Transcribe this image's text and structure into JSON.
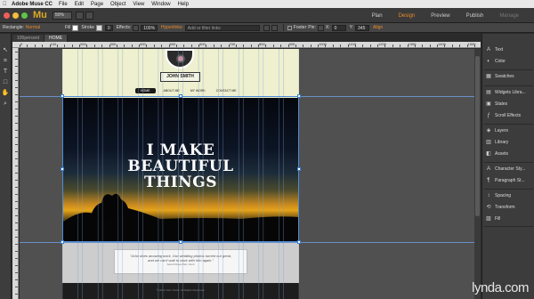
{
  "menubar": {
    "app_name": "Adobe Muse CC",
    "items": [
      "File",
      "Edit",
      "Page",
      "Object",
      "View",
      "Window",
      "Help"
    ]
  },
  "appbar": {
    "logo": "Mu",
    "zoom": "50%",
    "modes": [
      "Plan",
      "Design",
      "Preview",
      "Publish",
      "Manage"
    ],
    "active_mode": "Design",
    "colors": {
      "traffic_red": "#ee5f58",
      "traffic_yellow": "#f5bd3d",
      "traffic_green": "#5fc549",
      "accent": "#e98a2a"
    }
  },
  "controlbar": {
    "selection_label": "Rectangle:",
    "selection_value": "Normal",
    "fill_label": "Fill",
    "stroke_label": "Stroke",
    "stroke_value": "0",
    "effects_label": "Effects:",
    "opacity_value": "100%",
    "hyperlinks_label": "Hyperlinks:",
    "hyperlinks_placeholder": "Add or filter links",
    "footer_label": "Footer",
    "pin_label": "Pin:",
    "x_label": "X:",
    "x_value": "0",
    "y_label": "Y:",
    "y_value": "345",
    "align_label": "Align"
  },
  "doctabs": [
    "100percent",
    "HOME"
  ],
  "ruler": {
    "labels": [
      "0",
      "100",
      "200",
      "300",
      "400",
      "500",
      "600",
      "700",
      "800",
      "900",
      "1000",
      "1100",
      "1200",
      "1300",
      "1400",
      "1500"
    ]
  },
  "site": {
    "name": "JOHN SMITH",
    "nav": [
      "HOME",
      "ABOUT ME",
      "MY WORK",
      "CONTACT ME"
    ],
    "hero_lines": [
      "I MAKE",
      "BEAUTIFUL",
      "THINGS"
    ],
    "quote_lines": [
      "\"John does amazing work. Our wedding photos turned out great,",
      "and we can't wait to work with him again.\""
    ],
    "quote_author": "Sarah Rosenthal, client",
    "footer": "© 2014 John Smith. All Rights Reserved."
  },
  "panels": [
    {
      "icon": "text-icon",
      "glyph": "A",
      "label": "Text"
    },
    {
      "icon": "color-icon",
      "glyph": "◐",
      "label": "Color"
    },
    {
      "icon": "swatches-icon",
      "glyph": "▦",
      "label": "Swatches"
    },
    {
      "icon": "widgets-library-icon",
      "glyph": "▤",
      "label": "Widgets Libra..."
    },
    {
      "icon": "states-icon",
      "glyph": "▣",
      "label": "States"
    },
    {
      "icon": "scroll-effects-icon",
      "glyph": "ƒ",
      "label": "Scroll Effects"
    },
    {
      "icon": "layers-icon",
      "glyph": "◈",
      "label": "Layers"
    },
    {
      "icon": "library-icon",
      "glyph": "▥",
      "label": "Library"
    },
    {
      "icon": "assets-icon",
      "glyph": "◧",
      "label": "Assets"
    },
    {
      "icon": "character-styles-icon",
      "glyph": "A",
      "label": "Character Sty..."
    },
    {
      "icon": "paragraph-styles-icon",
      "glyph": "¶",
      "label": "Paragraph St..."
    },
    {
      "icon": "spacing-icon",
      "glyph": "↕",
      "label": "Spacing"
    },
    {
      "icon": "transform-icon",
      "glyph": "⟲",
      "label": "Transform"
    },
    {
      "icon": "fill-icon",
      "glyph": "▨",
      "label": "Fill"
    }
  ],
  "watermark": "lynda.com"
}
